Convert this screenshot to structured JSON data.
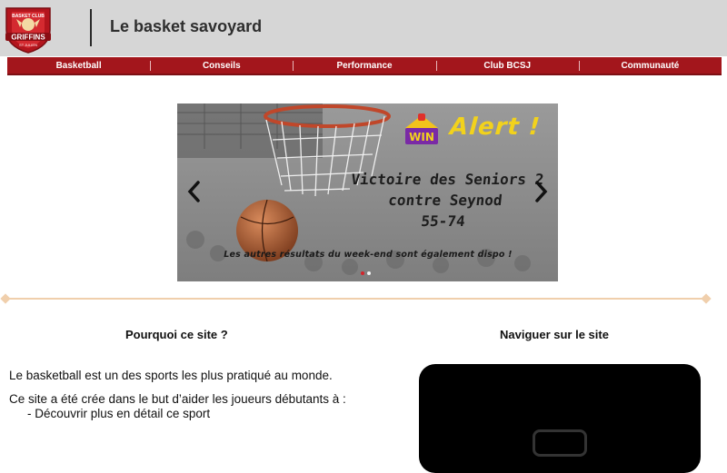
{
  "header": {
    "title": "Le basket savoyard",
    "logo_text_top": "BASKET CLUB",
    "logo_text_main": "GRIFFINS",
    "logo_text_bottom": "ST JULIEN"
  },
  "nav": {
    "items": [
      "Basketball",
      "Conseils",
      "Performance",
      "Club BCSJ",
      "Communauté"
    ]
  },
  "carousel": {
    "badge": "WIN",
    "alert": "Alert !",
    "headline_line1": "Victoire des Seniors 2",
    "headline_line2": "contre Seynod",
    "headline_line3": "55-74",
    "subline": "Les autres résultats du week-end sont également dispo !",
    "slides_count": 2,
    "active_slide": 1
  },
  "why": {
    "title": "Pourquoi ce site ?",
    "p1": "Le basketball est un des sports les plus pratiqué au monde.",
    "p2": "Ce site a été crée dans le but d’aider les joueurs débutants à :",
    "bullet1": "Découvrir plus en détail ce sport"
  },
  "navigate": {
    "title": "Naviguer sur le site"
  },
  "colors": {
    "brand_red": "#a3161c",
    "header_gray": "#d6d6d6",
    "alert_yellow": "#f2d21c",
    "separator": "#f0cfac"
  }
}
